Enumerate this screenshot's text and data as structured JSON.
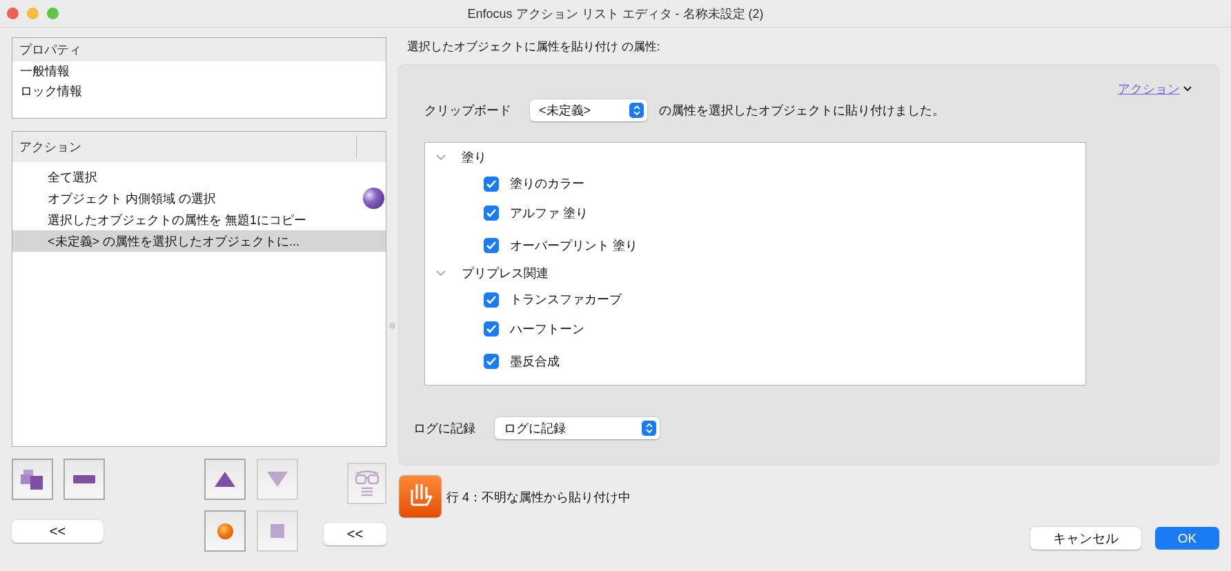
{
  "window": {
    "title": "Enfocus アクション リスト エディタ - 名称未設定 (2)"
  },
  "properties": {
    "header": "プロパティ",
    "items": [
      {
        "label": "一般情報",
        "selected": false
      },
      {
        "label": "ロック情報",
        "selected": false
      }
    ]
  },
  "actions": {
    "header": "アクション",
    "items": [
      {
        "label": "全て選択",
        "selected": false,
        "marked": false
      },
      {
        "label": "オブジェクト 内側領域 の選択",
        "selected": false,
        "marked": true
      },
      {
        "label": "選択したオブジェクトの属性を 無題1にコピー",
        "selected": false,
        "marked": false
      },
      {
        "label": "<未定義> の属性を選択したオブジェクトに...",
        "selected": true,
        "marked": false
      }
    ]
  },
  "toolbar": [
    {
      "kind": "duplicate",
      "disabled": false
    },
    {
      "kind": "remove",
      "disabled": false
    },
    {
      "kind": "up",
      "disabled": false
    },
    {
      "kind": "down",
      "disabled": true
    },
    {
      "kind": "inspect",
      "disabled": true
    },
    {
      "kind": "record",
      "disabled": false
    },
    {
      "kind": "stop",
      "disabled": true
    }
  ],
  "collapse_buttons": [
    "<<",
    "<<"
  ],
  "detail": {
    "heading": "選択したオブジェクトに属性を貼り付け の属性:",
    "action_menu": "アクション",
    "clipboard": {
      "label": "クリップボード",
      "value": "<未定義>",
      "suffix": "の属性を選択したオブジェクトに貼り付けました。"
    },
    "tree": [
      {
        "label": "塗り",
        "expanded": true,
        "children": [
          {
            "label": "塗りのカラー",
            "checked": true
          },
          {
            "label": "アルファ 塗り",
            "checked": true
          },
          {
            "label": "オーバープリント 塗り",
            "checked": true
          }
        ]
      },
      {
        "label": "プリプレス関連",
        "expanded": true,
        "children": [
          {
            "label": "トランスファカーブ",
            "checked": true
          },
          {
            "label": "ハーフトーン",
            "checked": true
          },
          {
            "label": "墨反合成",
            "checked": true
          }
        ]
      }
    ],
    "log": {
      "label": "ログに記録",
      "value": "ログに記録"
    }
  },
  "status": {
    "text": "行 4：不明な属性から貼り付け中"
  },
  "buttons": {
    "cancel": "キャンセル",
    "ok": "OK"
  }
}
